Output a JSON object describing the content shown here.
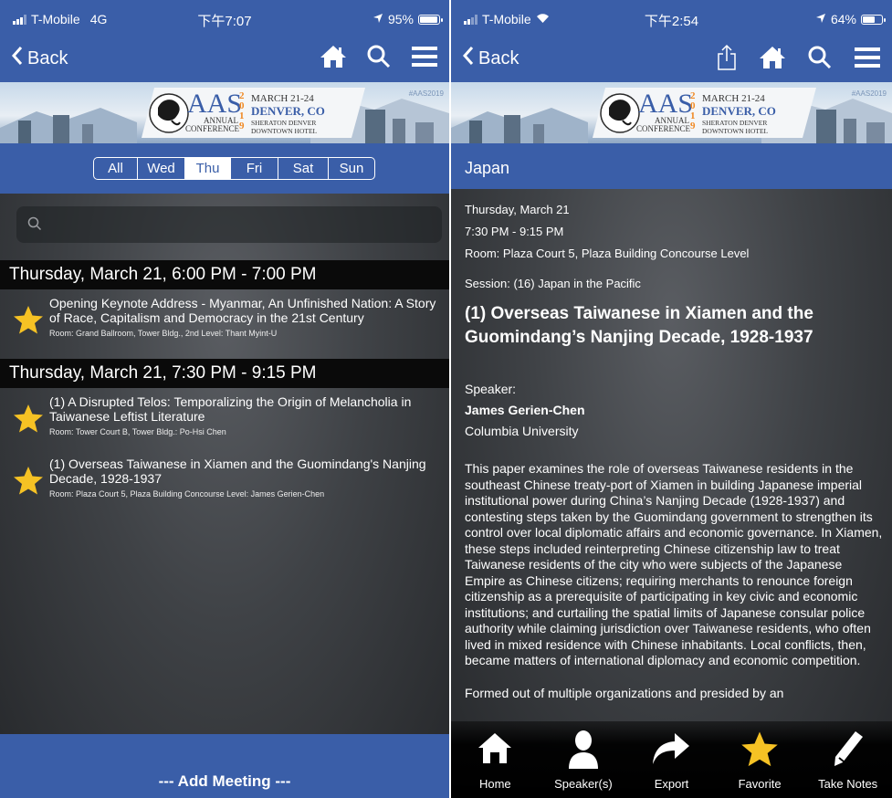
{
  "left": {
    "status": {
      "carrier": "T-Mobile",
      "network": "4G",
      "time": "下午7:07",
      "battery": "95%",
      "battery_level": 0.95
    },
    "nav": {
      "back_label": "Back"
    },
    "banner": {
      "aas": "AAS",
      "annual": "ANNUAL",
      "conference": "CONFERENCE",
      "year_digits": [
        "2",
        "0",
        "1",
        "9"
      ],
      "dates": "MARCH 21-24",
      "city": "DENVER, CO",
      "hotel1": "SHERATON DENVER",
      "hotel2": "DOWNTOWN HOTEL",
      "hashtag": "#AAS2019"
    },
    "days": [
      "All",
      "Wed",
      "Thu",
      "Fri",
      "Sat",
      "Sun"
    ],
    "active_day": "Thu",
    "sections": [
      {
        "header": "Thursday, March 21, 6:00 PM - 7:00 PM",
        "items": [
          {
            "title": "Opening Keynote Address - Myanmar, An Unfinished Nation: A Story of Race, Capitalism and Democracy in the 21st Century",
            "room": "Room: Grand Ballroom, Tower Bldg., 2nd Level: Thant Myint-U"
          }
        ]
      },
      {
        "header": "Thursday, March 21, 7:30 PM - 9:15 PM",
        "items": [
          {
            "title": "(1) A Disrupted Telos: Temporalizing the Origin of Melancholia in Taiwanese Leftist Literature",
            "room": "Room: Tower Court B, Tower Bldg.: Po-Hsi Chen"
          },
          {
            "title": "(1) Overseas Taiwanese in Xiamen and the Guomindang's Nanjing Decade, 1928-1937",
            "room": "Room: Plaza Court 5, Plaza Building Concourse Level: James Gerien-Chen"
          }
        ]
      }
    ],
    "add_meeting": "--- Add Meeting ---"
  },
  "right": {
    "status": {
      "carrier": "T-Mobile",
      "time": "下午2:54",
      "battery": "64%",
      "battery_level": 0.64
    },
    "nav": {
      "back_label": "Back"
    },
    "page_title": "Japan",
    "date": "Thursday, March 21",
    "time": "7:30 PM - 9:15 PM",
    "room": "Room: Plaza Court 5, Plaza Building Concourse Level",
    "session": "Session: (16) Japan in the Pacific",
    "title": "(1) Overseas Taiwanese in Xiamen and the Guomindang’s Nanjing Decade, 1928-1937",
    "speaker_label": "Speaker:",
    "speaker_name": "James Gerien-Chen",
    "speaker_affiliation": "Columbia University",
    "abstract": "This paper examines the role of overseas Taiwanese residents in the southeast Chinese treaty-port of Xiamen in building Japanese imperial institutional power during China’s Nanjing Decade (1928-1937) and contesting steps taken by the Guomindang government to strengthen its control over local diplomatic affairs and economic governance. In Xiamen, these steps included reinterpreting Chinese citizenship law to treat Taiwanese residents of the city who were subjects of the Japanese Empire as Chinese citizens; requiring merchants to renounce foreign citizenship as a prerequisite of participating in key civic and economic institutions; and curtailing the spatial limits of Japanese consular police authority while claiming jurisdiction over Taiwanese residents, who often lived in mixed residence with Chinese inhabitants. Local conflicts, then, became matters of international diplomacy and economic competition.",
    "abstract_cont": "Formed out of multiple organizations and presided by an",
    "tabs": [
      "Home",
      "Speaker(s)",
      "Export",
      "Favorite",
      "Take Notes"
    ],
    "colors": {
      "accent_blue": "#3a5ea8",
      "star_yellow": "#f6c224"
    }
  }
}
